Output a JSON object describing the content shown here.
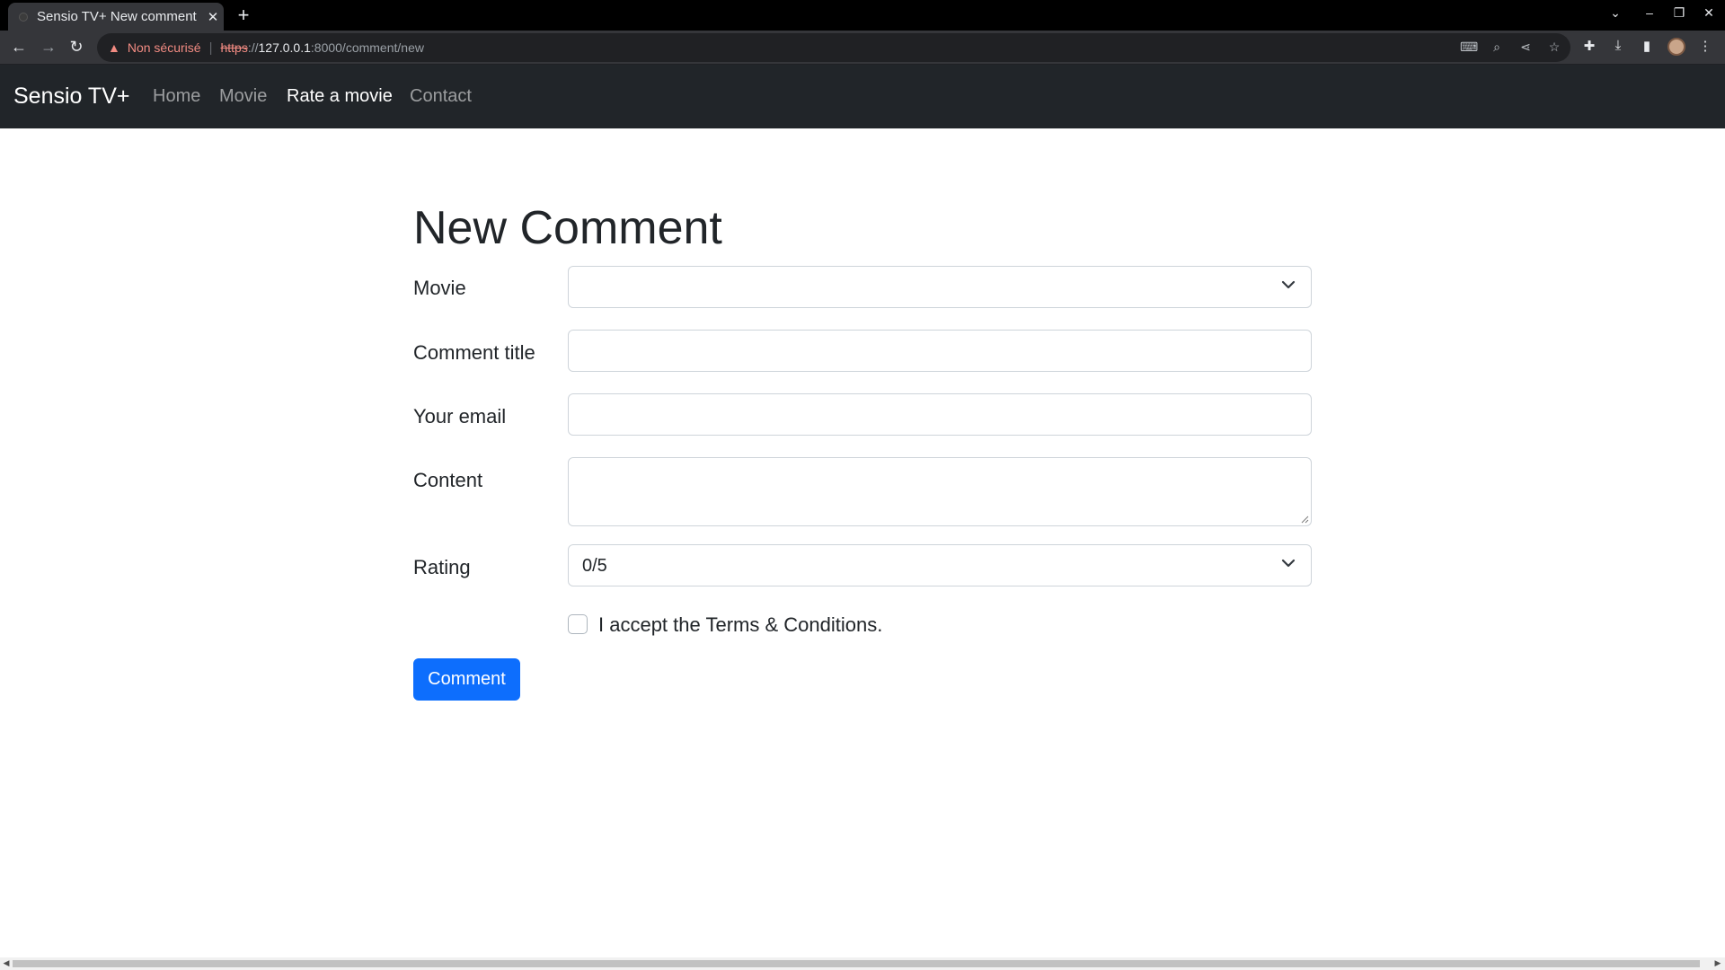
{
  "browser": {
    "tab_title": "Sensio TV+ New comment",
    "tab_close": "✕",
    "new_tab": "+",
    "security_label": "Non sécurisé",
    "url_scheme": "https",
    "url_separator": "://",
    "url_host": "127.0.0.1",
    "url_path": ":8000/comment/new",
    "icons": [
      "back-icon",
      "forward-icon",
      "reload-icon",
      "warning-icon",
      "translate-icon",
      "zoom-icon",
      "share-icon",
      "star-icon",
      "extensions-icon",
      "download-icon",
      "sidepanel-icon",
      "profile-avatar",
      "menu-icon"
    ]
  },
  "site": {
    "brand": "Sensio TV+",
    "nav": [
      {
        "label": "Home",
        "active": false
      },
      {
        "label": "Movie",
        "active": false
      },
      {
        "label": "Rate a movie",
        "active": true
      },
      {
        "label": "Contact",
        "active": false
      }
    ]
  },
  "form": {
    "heading": "New Comment",
    "movie_label": "Movie",
    "movie_value": "",
    "title_label": "Comment title",
    "title_value": "",
    "email_label": "Your email",
    "email_value": "",
    "content_label": "Content",
    "content_value": "",
    "rating_label": "Rating",
    "rating_value": "0/5",
    "terms_label": "I accept the Terms & Conditions.",
    "terms_checked": false,
    "submit_label": "Comment"
  },
  "colors": {
    "navbar_bg": "#212529",
    "primary": "#0d6efd",
    "text": "#212529",
    "border": "#ced4da"
  }
}
